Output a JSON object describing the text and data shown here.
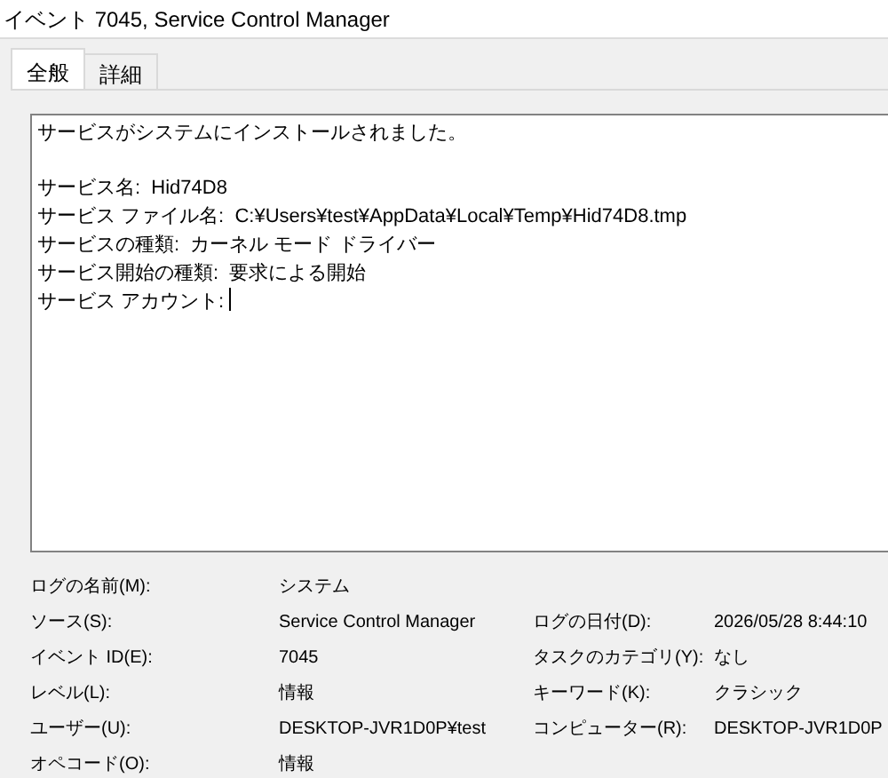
{
  "window": {
    "title": "イベント 7045, Service Control Manager"
  },
  "tabs": [
    {
      "label": "全般",
      "selected": true
    },
    {
      "label": "詳細",
      "selected": false
    }
  ],
  "message": {
    "summary": "サービスがシステムにインストールされました。",
    "lines": [
      "サービス名:  Hid74D8",
      "サービス ファイル名:  C:¥Users¥test¥AppData¥Local¥Temp¥Hid74D8.tmp",
      "サービスの種類:  カーネル モード ドライバー",
      "サービス開始の種類:  要求による開始",
      "サービス アカウント: "
    ]
  },
  "details": [
    {
      "fields": [
        {
          "label": "ログの名前(M):",
          "value": "システム"
        }
      ]
    },
    {
      "fields": [
        {
          "label": "ソース(S):",
          "value": "Service Control Manager"
        },
        {
          "label": "ログの日付(D):",
          "value": "2026/05/28 8:44:10"
        }
      ]
    },
    {
      "fields": [
        {
          "label": "イベント ID(E):",
          "value": "7045"
        },
        {
          "label": "タスクのカテゴリ(Y):",
          "value": "なし"
        }
      ]
    },
    {
      "fields": [
        {
          "label": "レベル(L):",
          "value": "情報"
        },
        {
          "label": "キーワード(K):",
          "value": "クラシック"
        }
      ]
    },
    {
      "fields": [
        {
          "label": "ユーザー(U):",
          "value": "DESKTOP-JVR1D0P¥test"
        },
        {
          "label": "コンピューター(R):",
          "value": "DESKTOP-JVR1D0P"
        }
      ]
    },
    {
      "fields": [
        {
          "label": "オペコード(O):",
          "value": "情報"
        }
      ]
    }
  ]
}
